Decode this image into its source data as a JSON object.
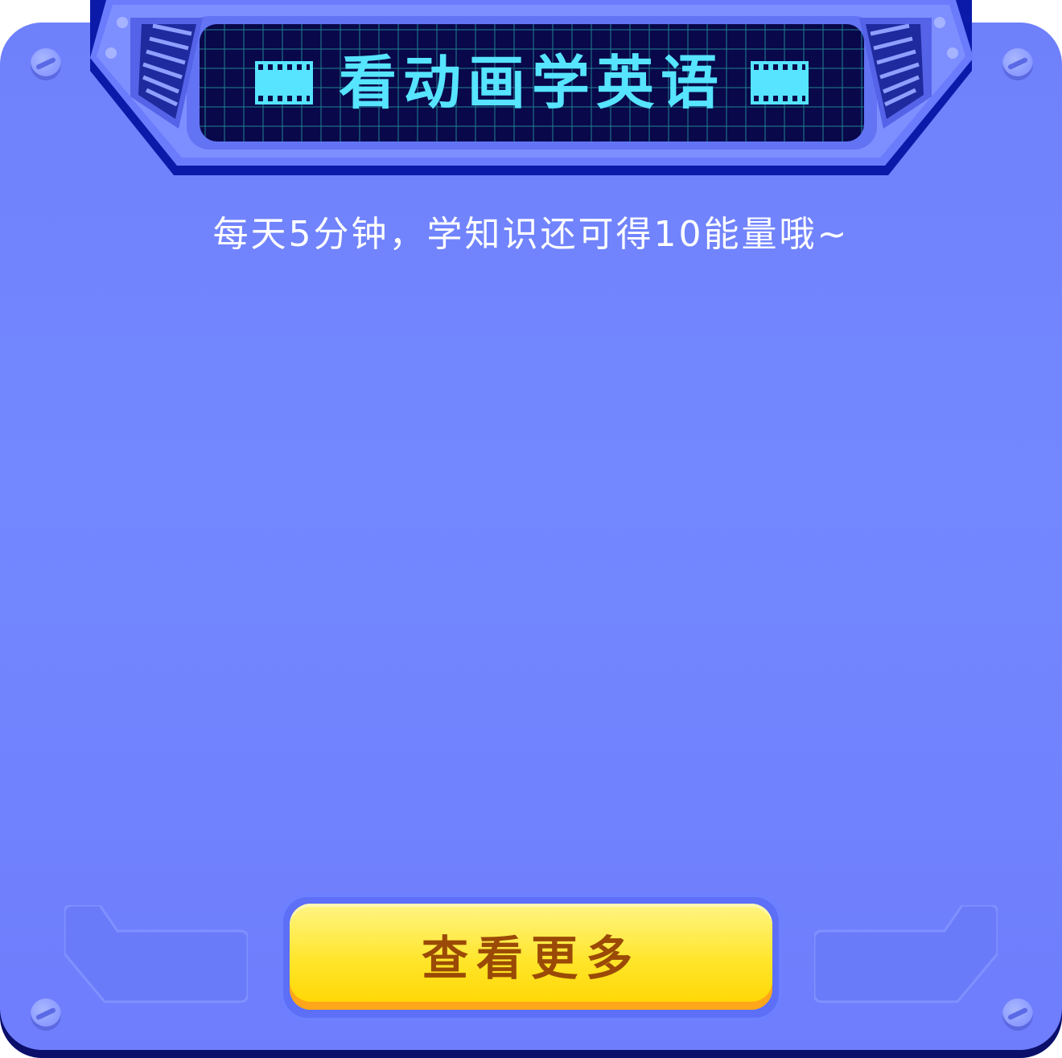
{
  "header": {
    "title": "看动画学英语",
    "title_color": "#56E4FF",
    "screen_background": "#08084A",
    "left_icon": "film-strip-icon",
    "right_icon": "film-strip-icon"
  },
  "subtitle": "每天5分钟，学知识还可得10能量哦~",
  "action": {
    "label": "查看更多",
    "button_color": "#FFE12A",
    "label_color": "#9A4A06"
  },
  "theme": {
    "panel_color": "#7388FF",
    "frame_dark": "#0B1AA8"
  }
}
